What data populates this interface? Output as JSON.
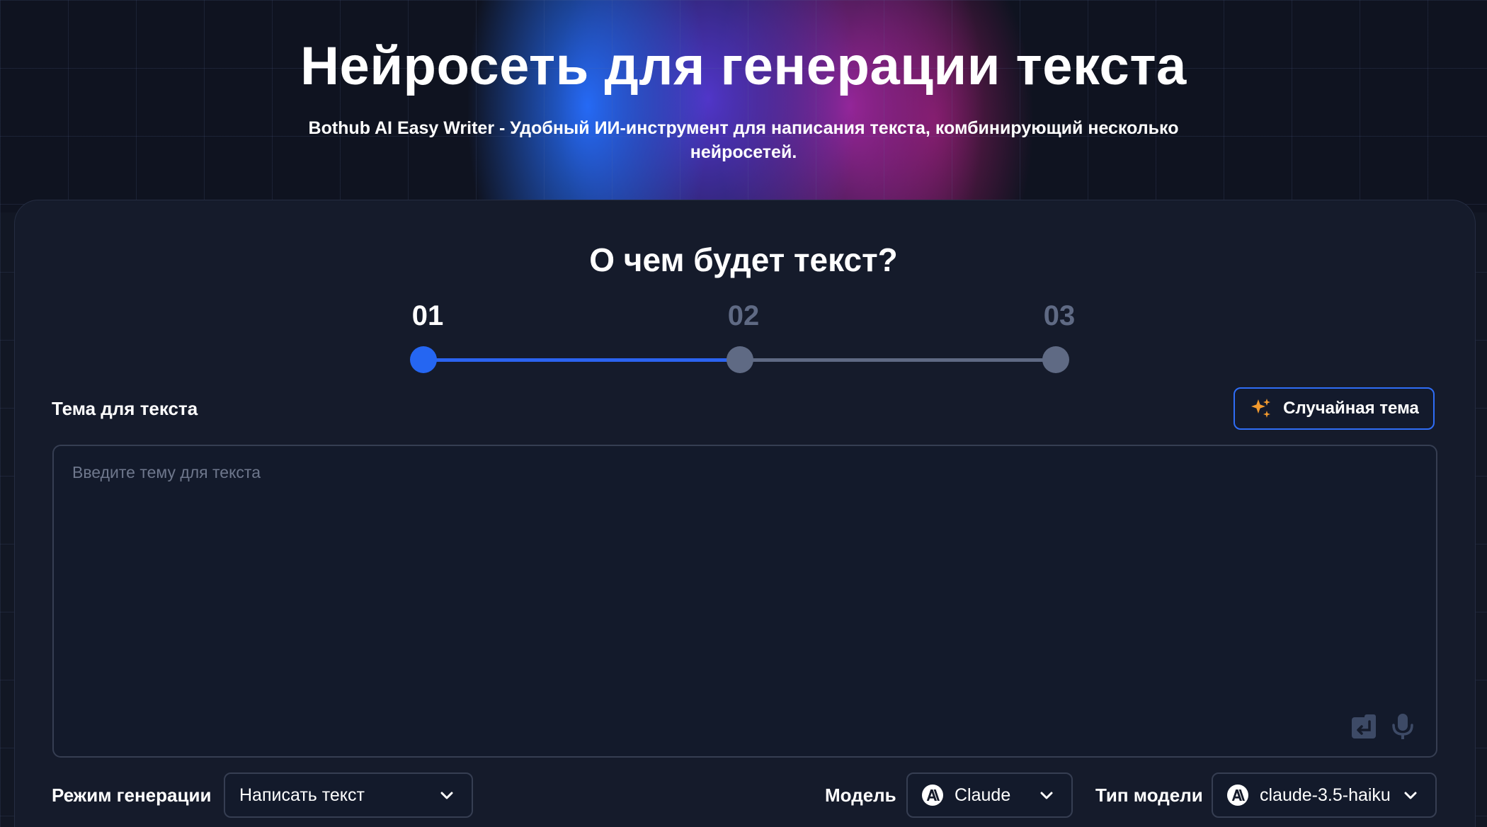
{
  "hero": {
    "title": "Нейросеть для генерации текста",
    "subtitle": "Bothub AI Easy Writer - Удобный ИИ-инструмент для написания текста, комбинирующий несколько нейросетей."
  },
  "form": {
    "heading": "О чем будет текст?",
    "steps": [
      {
        "number": "01",
        "state": "active"
      },
      {
        "number": "02",
        "state": "inactive"
      },
      {
        "number": "03",
        "state": "inactive"
      }
    ],
    "topic_label": "Тема для текста",
    "random_topic_button": "Случайная тема",
    "topic_placeholder": "Введите тему для текста",
    "topic_value": "",
    "generation_mode": {
      "label": "Режим генерации",
      "value": "Написать текст"
    },
    "model": {
      "label": "Модель",
      "value": "Claude",
      "icon": "anthropic-icon"
    },
    "model_type": {
      "label": "Тип модели",
      "value": "claude-3.5-haiku",
      "icon": "anthropic-icon"
    }
  },
  "icons": {
    "random_topic": "sparkles-icon",
    "enter": "enter-key-icon",
    "microphone": "microphone-icon",
    "dropdown": "chevron-down-icon"
  },
  "colors": {
    "background": "#121724",
    "panel": "#151b2b",
    "accent_blue": "#2b63f0",
    "step_inactive": "#5f6a84",
    "sparkle_orange": "#f29a2e",
    "border": "#363e52"
  }
}
